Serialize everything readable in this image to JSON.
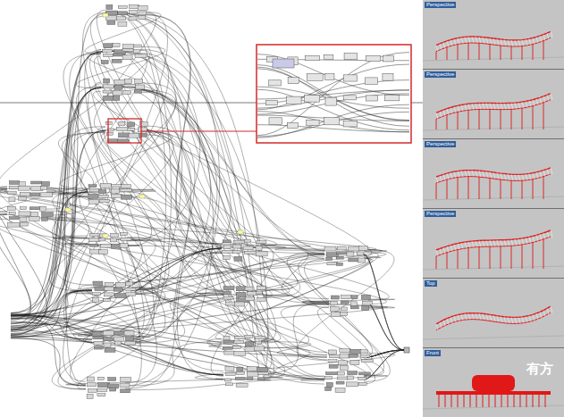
{
  "viewports": [
    {
      "label": "Perspective"
    },
    {
      "label": "Perspective"
    },
    {
      "label": "Perspective"
    },
    {
      "label": "Perspective"
    },
    {
      "label": "Top"
    },
    {
      "label": "Front"
    }
  ],
  "watermark": "有方"
}
